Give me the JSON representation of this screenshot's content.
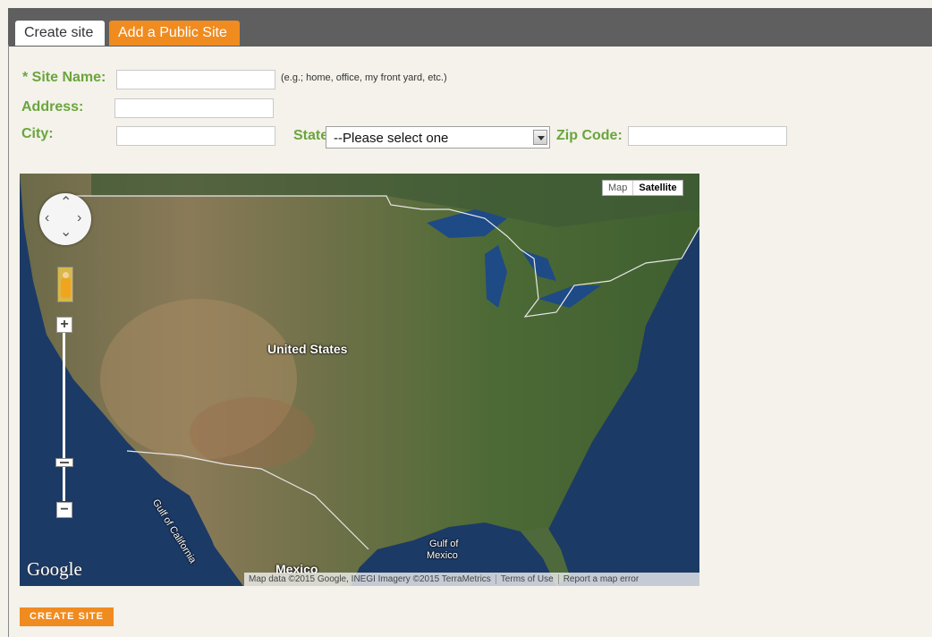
{
  "tabs": {
    "create": "Create site",
    "public": "Add a Public Site"
  },
  "form": {
    "site_name_label": "* Site Name:",
    "site_name_value": "",
    "site_name_hint": "(e.g.; home, office, my front yard, etc.)",
    "address_label": "Address:",
    "address_value": "",
    "city_label": "City:",
    "city_value": "",
    "state_label": "State:",
    "state_selected": "--Please select one",
    "zip_label": "Zip Code:",
    "zip_value": ""
  },
  "map": {
    "type_map": "Map",
    "type_satellite": "Satellite",
    "label_us": "United States",
    "label_mexico": "Mexico",
    "label_gulf_ca": "Gulf of California",
    "label_gulf_mx_1": "Gulf of",
    "label_gulf_mx_2": "Mexico",
    "logo": "Google",
    "attribution": "Map data ©2015 Google, INEGI Imagery ©2015 TerraMetrics",
    "terms": "Terms of Use",
    "report": "Report a map error",
    "zoom_in": "+",
    "zoom_out": "−",
    "icons": [
      "pan-control-icon",
      "pegman-icon",
      "zoom-in-icon",
      "zoom-out-icon"
    ]
  },
  "actions": {
    "create_site": "CREATE SITE"
  },
  "colors": {
    "accent": "#f08b1f",
    "label_green": "#6aa53d",
    "tabbar": "#5f5f5f",
    "background": "#f4f2ea"
  }
}
